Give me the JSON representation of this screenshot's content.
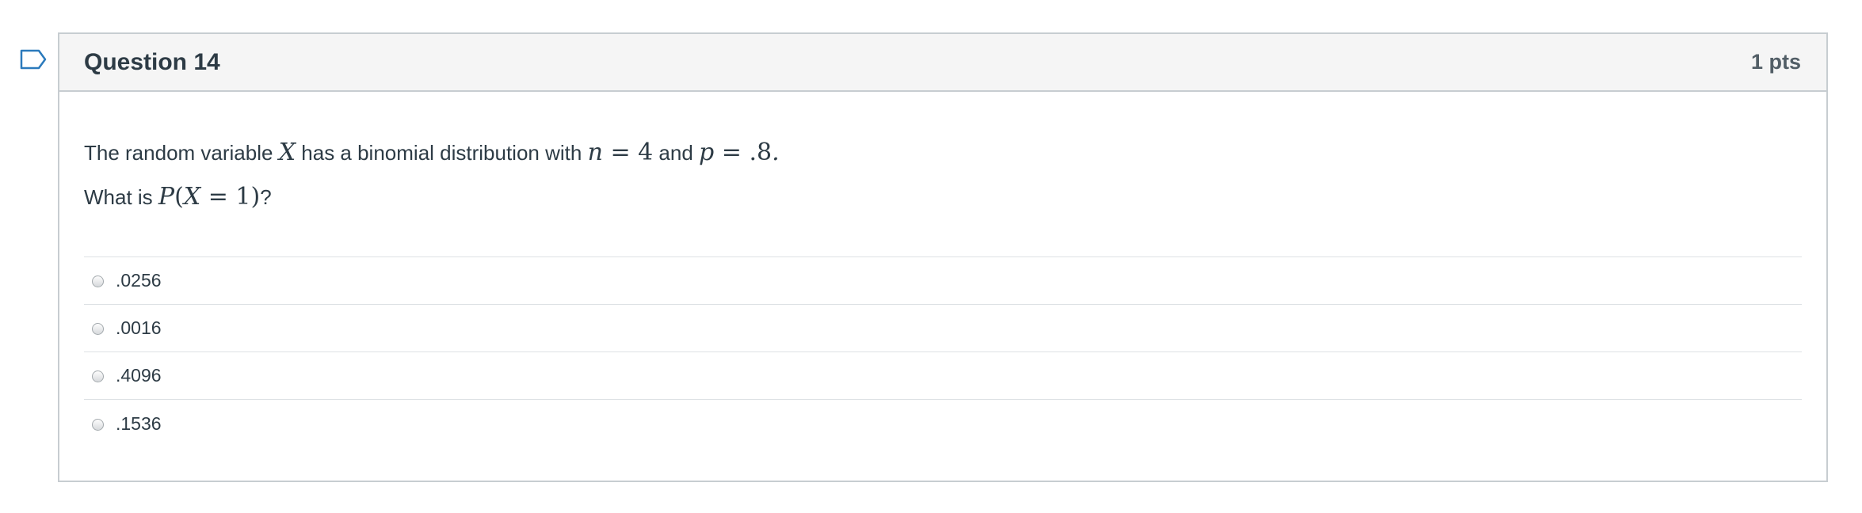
{
  "question": {
    "title": "Question 14",
    "points": "1 pts",
    "text_line1": {
      "part1": "The random variable ",
      "var_x": "X",
      "part2": " has a binomial distribution with ",
      "n_var": "n",
      "n_eq": " = 4",
      "part3": " and ",
      "p_var": "p",
      "p_eq": " = .8",
      "part4": "."
    },
    "text_line2": {
      "part1": "What is ",
      "p_var": "P",
      "open": "(",
      "x_var": "X",
      "eq": " = 1)",
      "part2": "?"
    }
  },
  "answers": [
    {
      "label": ".0256",
      "selected": false
    },
    {
      "label": ".0016",
      "selected": false
    },
    {
      "label": ".4096",
      "selected": false
    },
    {
      "label": ".1536",
      "selected": false
    }
  ],
  "colors": {
    "header_bg": "#f5f5f5",
    "border": "#c7cdd1",
    "text": "#2d3b45",
    "flag_stroke": "#2b7abc"
  },
  "icons": {
    "flag": "bookmark-flag-icon",
    "radio": "radio-button-icon"
  }
}
